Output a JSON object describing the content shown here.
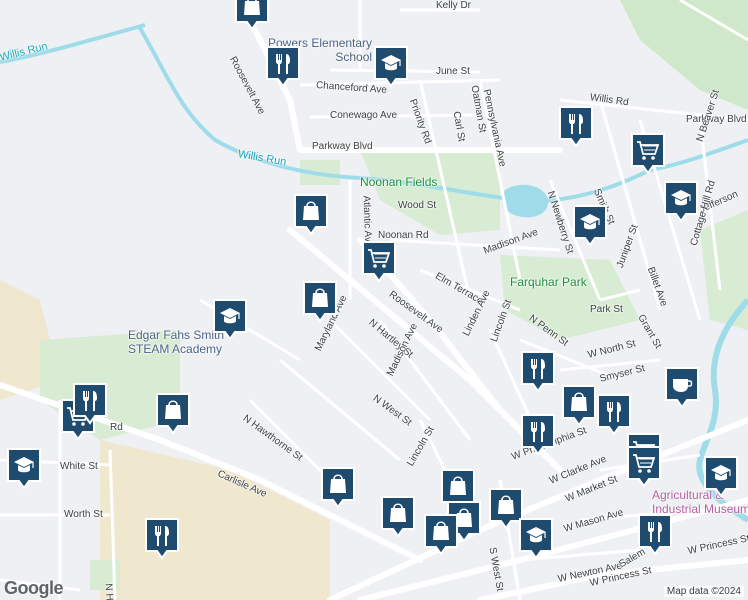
{
  "map": {
    "attribution": "Map data ©2024",
    "logo_text": "Google",
    "colors": {
      "marker": "#1f4b6e",
      "street": "#ffffff",
      "background": "#eef0f3",
      "park": "#d7ecd3",
      "water": "#b3e5f0",
      "industrial": "#f0e7cf"
    },
    "labels": {
      "willis_run_west": "Willis Run",
      "willis_run_center": "Willis Run",
      "roosevelt_ave_north": "Roosevelt Ave",
      "chanceford_ave": "Chanceford Ave",
      "conewago_ave": "Conewago Ave",
      "parkway_blvd_west": "Parkway Blvd",
      "june_st": "June St",
      "kelly_dr": "Kelly Dr",
      "willis_rd": "Willis Rd",
      "parkway_blvd_east": "Parkway Blvd",
      "priority_rd": "Priority Rd",
      "carl_st": "Carl St",
      "oatman_st": "Oatman St",
      "pennsylvania_ave": "Pennsylvania Ave",
      "noonan_fields": "Noonan Fields",
      "wood_st": "Wood St",
      "atlantic_ave": "Atlantic Ave",
      "noonan_rd": "Noonan Rd",
      "n_newberry_st": "N Newberry St",
      "smith_st": "Smith St",
      "jefferson": "Jefferson",
      "n_beaver_st": "N Beaver St",
      "madison_ave_east": "Madison Ave",
      "elm_terrace": "Elm Terrace",
      "farquhar_park": "Farquhar Park",
      "roosevelt_ave_center": "Roosevelt Ave",
      "n_hartley_st": "N Hartley St",
      "maryland_ave": "Maryland Ave",
      "linden_ave": "Linden Ave",
      "n_penn_st": "N Penn St",
      "park_st": "Park St",
      "juniper_st": "Juniper St",
      "billet_ave": "Billet Ave",
      "grant_st": "Grant St",
      "cottage_hill_rd": "Cottage Hill Rd",
      "edgar_fahs_smith": "Edgar Fahs Smith\nSTEAM Academy",
      "madison_ave_center": "Madison Ave",
      "lincoln_st_n": "Lincoln St",
      "w_north_st": "W North St",
      "smyser_st": "Smyser St",
      "n_west_st": "N West St",
      "n_hawthorne_st": "N Hawthorne St",
      "w_philadelphia_st": "W Philadelphia St",
      "w_clarke_ave": "W Clarke Ave",
      "lincoln_st_s": "Lincoln St",
      "carlisle_ave": "Carlisle Ave",
      "white_st": "White St",
      "worth_st": "Worth St",
      "w_market_st": "W Market St",
      "w_mason_ave": "W Mason Ave",
      "s_west_st": "S West St",
      "agricultural_museum": "Agricultural &\nIndustrial Museum",
      "w_newton_ave": "W Newton Ave",
      "w_princess_st": "W Princess St",
      "w_princess_st_east": "W Princess St",
      "salem": "Salem",
      "n_highland": "N High",
      "powers_elementary": "Powers Elementary\nSchool",
      "road_fragment": "Rd"
    },
    "markers": [
      {
        "id": "m1",
        "icon": "shopping-bag-icon"
      },
      {
        "id": "m2",
        "icon": "restaurant-icon"
      },
      {
        "id": "m3",
        "icon": "school-icon"
      },
      {
        "id": "m4",
        "icon": "restaurant-icon"
      },
      {
        "id": "m5",
        "icon": "grocery-cart-icon"
      },
      {
        "id": "m6",
        "icon": "school-icon"
      },
      {
        "id": "m7",
        "icon": "shopping-bag-icon"
      },
      {
        "id": "m8",
        "icon": "grocery-cart-icon"
      },
      {
        "id": "m9",
        "icon": "school-icon"
      },
      {
        "id": "m10",
        "icon": "shopping-bag-icon"
      },
      {
        "id": "m11",
        "icon": "school-icon"
      },
      {
        "id": "m12",
        "icon": "restaurant-icon"
      },
      {
        "id": "m13",
        "icon": "grocery-cart-icon"
      },
      {
        "id": "m14",
        "icon": "shopping-bag-icon"
      },
      {
        "id": "m15",
        "icon": "school-icon"
      },
      {
        "id": "m16",
        "icon": "restaurant-icon"
      },
      {
        "id": "m17",
        "icon": "coffee-icon"
      },
      {
        "id": "m18",
        "icon": "shopping-bag-icon"
      },
      {
        "id": "m19",
        "icon": "restaurant-icon"
      },
      {
        "id": "m20",
        "icon": "restaurant-icon"
      },
      {
        "id": "m21",
        "icon": "grocery-cart-icon"
      },
      {
        "id": "m22",
        "icon": "grocery-cart-icon"
      },
      {
        "id": "m23",
        "icon": "school-icon"
      },
      {
        "id": "m24",
        "icon": "shopping-bag-icon"
      },
      {
        "id": "m25",
        "icon": "shopping-bag-icon"
      },
      {
        "id": "m26",
        "icon": "shopping-bag-icon"
      },
      {
        "id": "m27",
        "icon": "shopping-bag-icon"
      },
      {
        "id": "m28",
        "icon": "shopping-bag-icon"
      },
      {
        "id": "m29",
        "icon": "shopping-bag-icon"
      },
      {
        "id": "m30",
        "icon": "school-icon"
      },
      {
        "id": "m31",
        "icon": "restaurant-icon"
      },
      {
        "id": "m32",
        "icon": "restaurant-icon"
      }
    ]
  }
}
